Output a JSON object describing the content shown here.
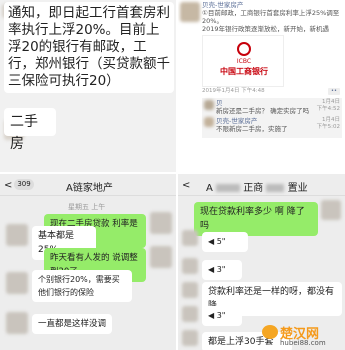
{
  "top_left": {
    "message": "通知，即日起工行首套房利率执行上浮20%。目前上浮20的银行有邮政，工行，郑州银行（买贷款额千三保险可执行20）",
    "reply": "二手房"
  },
  "top_right": {
    "post_author": "贝壳-世家房产",
    "post_text": "①目前邮政，工商银行首套房利率上浮25%调至20%。\n2019年银行政策逐渐放松，新开始，新机遇",
    "bank_logo_text": "ICBC",
    "bank_name": "中国工商银行",
    "post_time": "2019年1月4日",
    "post_time_suffix": "下午4:48",
    "comment1_author": "贝",
    "comment1_text": "新房还是二手房？ 确定实房了吗",
    "comment1_time": "1月4日",
    "comment1_time2": "下午4:52",
    "comment2_author": "贝壳-世家房产",
    "comment2_text": "不限新房二手房，实施了",
    "comment2_time": "1月4日",
    "comment2_time2": "下午5:02"
  },
  "bottom_left": {
    "back_count": "309",
    "title": "A链家地产",
    "date": "星期五 上午",
    "messages": [
      {
        "side": "right",
        "text": "现在二手房贷款 利率是多少呀"
      },
      {
        "side": "left",
        "text": "基本都是25%"
      },
      {
        "side": "right",
        "text": "昨天看有人发的 说调整到20了"
      },
      {
        "side": "left",
        "text": "个别银行20%，需要买他们银行的保险"
      },
      {
        "side": "left",
        "text": "一直都是这样没调"
      }
    ]
  },
  "bottom_right": {
    "title_prefix": "A",
    "title_suffix": "正商",
    "title_end": "置业",
    "messages": [
      {
        "side": "right",
        "text": "现在贷款利率多少 啊 降了吗"
      },
      {
        "side": "left",
        "text": "5\""
      },
      {
        "side": "left",
        "text": "3\""
      },
      {
        "side": "left",
        "text": "贷款利率还是一样的呀，都没有降"
      },
      {
        "side": "left",
        "text": "3\""
      },
      {
        "side": "left",
        "text": "都是上浮30手套"
      }
    ]
  },
  "watermark": {
    "text": "楚汉网",
    "url": "hubei88.com"
  }
}
